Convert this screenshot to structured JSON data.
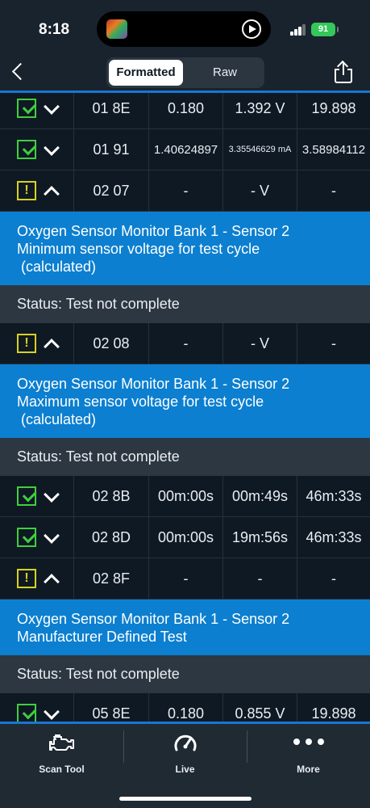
{
  "status_bar": {
    "time": "8:18",
    "battery": "91"
  },
  "nav": {
    "segments": [
      "Formatted",
      "Raw"
    ],
    "selected": "Formatted"
  },
  "rows": [
    {
      "type": "data",
      "status": "check",
      "expanded": false,
      "id": "01 8E",
      "v1": "0.180",
      "v2": "1.392 V",
      "v3": "19.898",
      "size": ""
    },
    {
      "type": "data",
      "status": "check",
      "expanded": false,
      "id": "01 91",
      "v1": "1.40624897",
      "v2": "3.35546629 mA",
      "v3": "3.58984112",
      "size": "small"
    },
    {
      "type": "data",
      "status": "warn",
      "expanded": true,
      "id": "02 07",
      "v1": "-",
      "v2": "- V",
      "v3": "-",
      "size": ""
    },
    {
      "type": "desc",
      "lines": [
        "Oxygen Sensor Monitor Bank 1 - Sensor 2",
        "Minimum sensor voltage for test cycle",
        " (calculated)"
      ]
    },
    {
      "type": "status",
      "text": "Status: Test not complete"
    },
    {
      "type": "data",
      "status": "warn",
      "expanded": true,
      "id": "02 08",
      "v1": "-",
      "v2": "- V",
      "v3": "-",
      "size": ""
    },
    {
      "type": "desc",
      "lines": [
        "Oxygen Sensor Monitor Bank 1 - Sensor 2",
        "Maximum sensor voltage for test cycle",
        " (calculated)"
      ]
    },
    {
      "type": "status",
      "text": "Status: Test not complete"
    },
    {
      "type": "data",
      "status": "check",
      "expanded": false,
      "id": "02 8B",
      "v1": "00m:00s",
      "v2": "00m:49s",
      "v3": "46m:33s",
      "size": ""
    },
    {
      "type": "data",
      "status": "check",
      "expanded": false,
      "id": "02 8D",
      "v1": "00m:00s",
      "v2": "19m:56s",
      "v3": "46m:33s",
      "size": ""
    },
    {
      "type": "data",
      "status": "warn",
      "expanded": true,
      "id": "02 8F",
      "v1": "-",
      "v2": "-",
      "v3": "-",
      "size": ""
    },
    {
      "type": "desc",
      "lines": [
        "Oxygen Sensor Monitor Bank 1 - Sensor 2",
        "Manufacturer Defined Test"
      ]
    },
    {
      "type": "status",
      "text": "Status: Test not complete"
    },
    {
      "type": "data",
      "status": "check",
      "expanded": false,
      "id": "05 8E",
      "v1": "0.180",
      "v2": "0.855 V",
      "v3": "19.898",
      "size": ""
    }
  ],
  "tabs": [
    {
      "label": "Scan Tool",
      "icon": "engine-icon"
    },
    {
      "label": "Live",
      "icon": "gauge-icon"
    },
    {
      "label": "More",
      "icon": "more-dots-icon"
    }
  ],
  "colors": {
    "accent": "#1976d2",
    "desc_bg": "#0c7fd0",
    "check": "#3fcf3f",
    "warn": "#d7d21e",
    "battery": "#34c759"
  }
}
